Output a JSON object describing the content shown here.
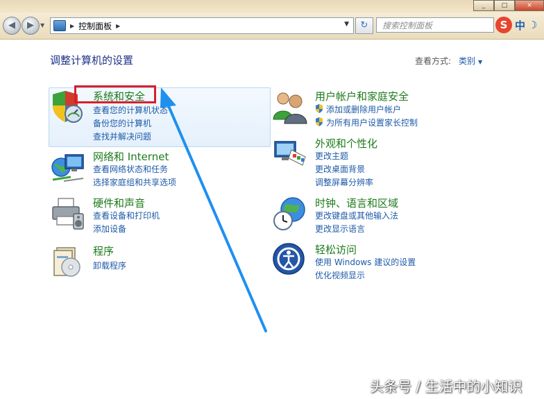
{
  "window": {
    "buttons": [
      "_",
      "□",
      "×"
    ]
  },
  "address_bar": {
    "path": [
      "控制面板"
    ],
    "search_placeholder": "搜索控制面板"
  },
  "ime": {
    "logo": "S",
    "mode": "中",
    "moon": "☽"
  },
  "header": {
    "title": "调整计算机的设置",
    "view_label": "查看方式:",
    "view_value": "类别"
  },
  "categories": [
    {
      "title": "系统和安全",
      "links": [
        "查看您的计算机状态",
        "备份您的计算机",
        "查找并解决问题"
      ],
      "icon": "shield-check-icon"
    },
    {
      "title": "网络和 Internet",
      "links": [
        "查看网络状态和任务",
        "选择家庭组和共享选项"
      ],
      "icon": "network-globe-icon"
    },
    {
      "title": "硬件和声音",
      "links": [
        "查看设备和打印机",
        "添加设备"
      ],
      "icon": "printer-icon"
    },
    {
      "title": "程序",
      "links": [
        "卸载程序"
      ],
      "icon": "programs-box-icon"
    },
    {
      "title": "用户帐户和家庭安全",
      "links": [
        "添加或删除用户帐户",
        "为所有用户设置家长控制"
      ],
      "icon": "users-icon"
    },
    {
      "title": "外观和个性化",
      "links": [
        "更改主题",
        "更改桌面背景",
        "调整屏幕分辨率"
      ],
      "icon": "display-paint-icon"
    },
    {
      "title": "时钟、语言和区域",
      "links": [
        "更改键盘或其他输入法",
        "更改显示语言"
      ],
      "icon": "clock-globe-icon"
    },
    {
      "title": "轻松访问",
      "links": [
        "使用 Windows 建议的设置",
        "优化视频显示"
      ],
      "icon": "ease-of-access-icon"
    }
  ],
  "watermark": "头条号 / 生活中的小知识",
  "colors": {
    "category_title": "#1c7a1c",
    "link": "#1e5aa8",
    "annotation_red": "#d81e2a",
    "annotation_arrow": "#1e90f0"
  }
}
